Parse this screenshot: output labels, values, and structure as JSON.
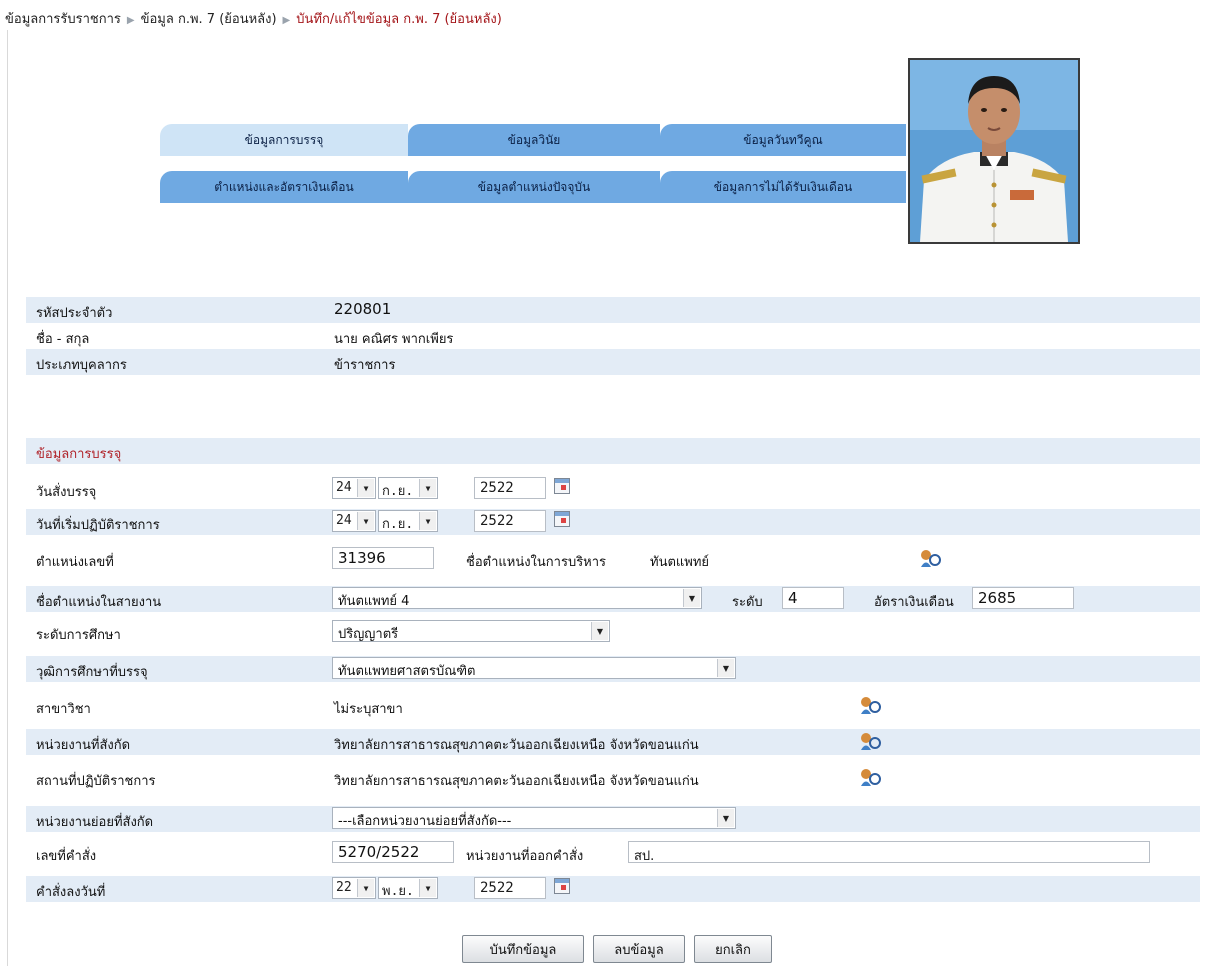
{
  "breadcrumb": {
    "item1": "ข้อมูลการรับราชการ",
    "item2": "ข้อมูล ก.พ. 7 (ย้อนหลัง)",
    "current": "บันทึก/แก้ไขข้อมูล ก.พ. 7 (ย้อนหลัง)"
  },
  "tabs": [
    {
      "label": "ข้อมูลการบรรจุ"
    },
    {
      "label": "ข้อมูลวินัย"
    },
    {
      "label": "ข้อมูลวันทวีคูณ"
    },
    {
      "label": "ตำแหน่งและอัตราเงินเดือน"
    },
    {
      "label": "ข้อมูลตำแหน่งปัจจุบัน"
    },
    {
      "label": "ข้อมูลการไม่ได้รับเงินเดือน"
    }
  ],
  "person": {
    "id_label": "รหัสประจำตัว",
    "id_value": "220801",
    "name_label": "ชื่อ - สกุล",
    "name_value": "นาย คณิศร พากเพียร",
    "type_label": "ประเภทบุคลากร",
    "type_value": "ข้าราชการ"
  },
  "form": {
    "section_title": "ข้อมูลการบรรจุ",
    "appoint_date_label": "วันสั่งบรรจุ",
    "appoint_date": {
      "day": "24",
      "month": "ก.ย.",
      "year": "2522"
    },
    "start_date_label": "วันที่เริ่มปฏิบัติราชการ",
    "start_date": {
      "day": "24",
      "month": "ก.ย.",
      "year": "2522"
    },
    "position_no_label": "ตำแหน่งเลขที่",
    "position_no": "31396",
    "admin_position_label": "ชื่อตำแหน่งในการบริหาร",
    "admin_position_value": "ทันตแพทย์",
    "line_position_label": "ชื่อตำแหน่งในสายงาน",
    "line_position_value": "ทันตแพทย์ 4",
    "level_label": "ระดับ",
    "level_value": "4",
    "salary_label": "อัตราเงินเดือน",
    "salary_value": "2685",
    "education_level_label": "ระดับการศึกษา",
    "education_level_value": "ปริญญาตรี",
    "qualification_label": "วุฒิการศึกษาที่บรรจุ",
    "qualification_value": "ทันตแพทยศาสตรบัณฑิต",
    "major_label": "สาขาวิชา",
    "major_value": "ไม่ระบุสาขา",
    "unit_label": "หน่วยงานที่สังกัด",
    "unit_value": "วิทยาลัยการสาธารณสุขภาคตะวันออกเฉียงเหนือ จังหวัดขอนแก่น",
    "workplace_label": "สถานที่ปฏิบัติราชการ",
    "workplace_value": "วิทยาลัยการสาธารณสุขภาคตะวันออกเฉียงเหนือ จังหวัดขอนแก่น",
    "subunit_label": "หน่วยงานย่อยที่สังกัด",
    "subunit_value": "---เลือกหน่วยงานย่อยที่สังกัด---",
    "order_no_label": "เลขที่คำสั่ง",
    "order_no_value": "5270/2522",
    "issuer_label": "หน่วยงานที่ออกคำสั่ง",
    "issuer_value": "สป.",
    "order_date_label": "คำสั่งลงวันที่",
    "order_date": {
      "day": "22",
      "month": "พ.ย.",
      "year": "2522"
    }
  },
  "buttons": {
    "save": "บันทึกข้อมูล",
    "delete": "ลบข้อมูล",
    "cancel": "ยกเลิก"
  },
  "colors": {
    "tab_active": "#cfe4f6",
    "tab_inactive": "#6fa9e2",
    "row_shade": "#e3ecf6",
    "section_red": "#b0232a"
  }
}
